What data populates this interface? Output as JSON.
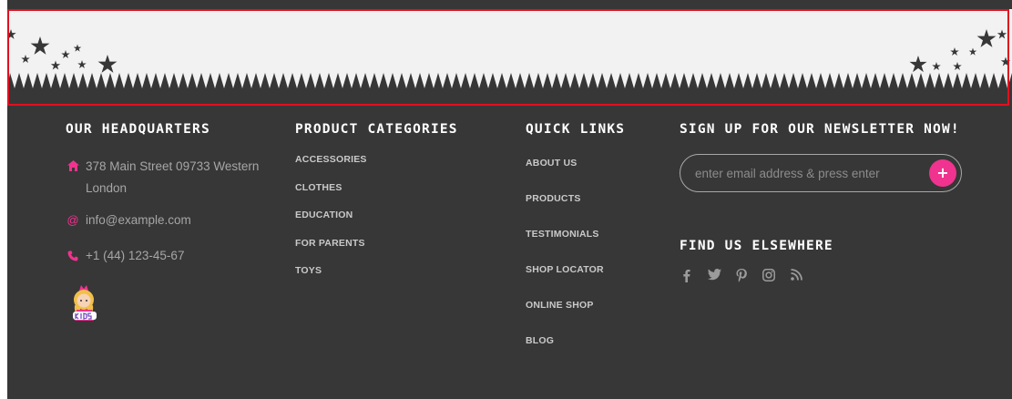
{
  "headquarters": {
    "title": "OUR HEADQUARTERS",
    "address": "378 Main Street 09733 Western London",
    "email": "info@example.com",
    "phone": "+1 (44) 123-45-67",
    "address_icon": "home-icon",
    "email_icon": "at-icon",
    "phone_icon": "phone-icon",
    "email_glyph": "@",
    "logo_text": "kids"
  },
  "categories": {
    "title": "PRODUCT CATEGORIES",
    "items": [
      "ACCESSORIES",
      "CLOTHES",
      "EDUCATION",
      "FOR PARENTS",
      "TOYS"
    ]
  },
  "quick_links": {
    "title": "QUICK LINKS",
    "items": [
      "ABOUT US",
      "PRODUCTS",
      "TESTIMONIALS",
      "SHOP LOCATOR",
      "ONLINE SHOP",
      "BLOG"
    ]
  },
  "newsletter": {
    "title": "SIGN UP FOR OUR NEWSLETTER NOW!",
    "placeholder": "enter email address & press enter",
    "value": "",
    "submit_glyph": "+"
  },
  "social": {
    "title": "FIND US ELSEWHERE",
    "icons": [
      "facebook-icon",
      "twitter-icon",
      "pinterest-icon",
      "instagram-icon",
      "rss-icon"
    ]
  },
  "colors": {
    "footer_bg": "#373737",
    "band_bg": "#f2f2f2",
    "accent": "#f0338f",
    "star": "#373737",
    "highlight": "#e01020"
  }
}
